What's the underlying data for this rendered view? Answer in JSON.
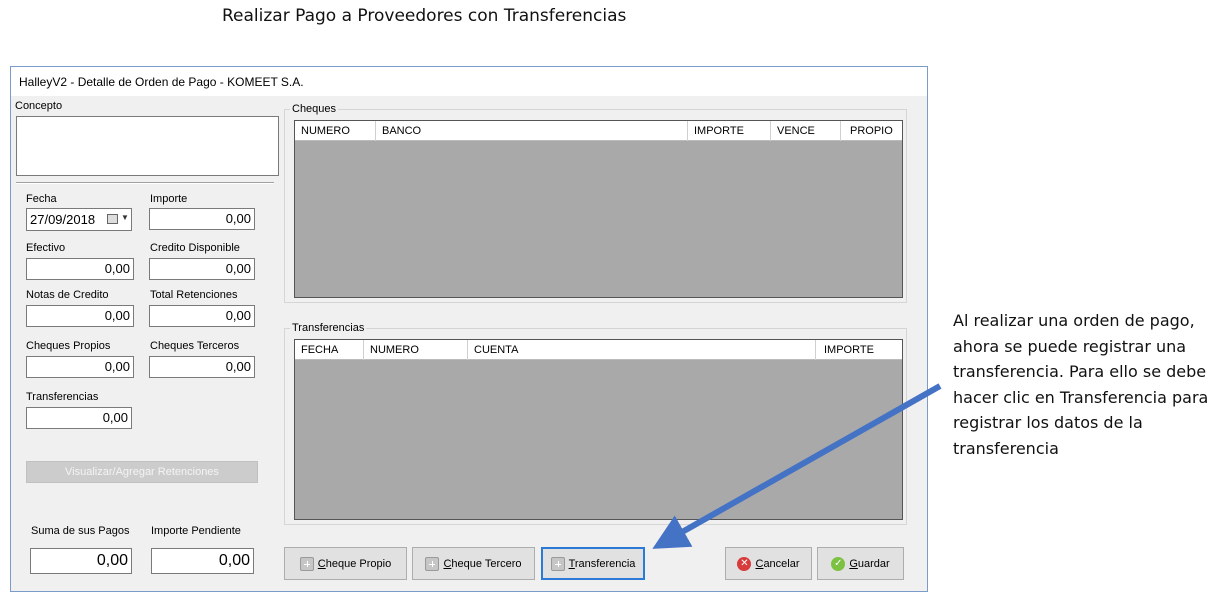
{
  "doc_title": "Realizar Pago a Proveedores con Transferencias",
  "window": {
    "title": "HalleyV2 - Detalle de Orden de Pago - KOMEET S.A."
  },
  "left": {
    "concepto_label": "Concepto",
    "concepto_value": "",
    "fecha_label": "Fecha",
    "fecha_value": "27/09/2018",
    "importe_label": "Importe",
    "importe_value": "0,00",
    "efectivo_label": "Efectivo",
    "efectivo_value": "0,00",
    "credito_label": "Credito Disponible",
    "credito_value": "0,00",
    "notas_label": "Notas de Credito",
    "notas_value": "0,00",
    "retenciones_label": "Total Retenciones",
    "retenciones_value": "0,00",
    "cheques_propios_label": "Cheques Propios",
    "cheques_propios_value": "0,00",
    "cheques_terceros_label": "Cheques Terceros",
    "cheques_terceros_value": "0,00",
    "transferencias_label": "Transferencias",
    "transferencias_value": "0,00",
    "retenciones_button": "Visualizar/Agregar Retenciones",
    "suma_label": "Suma de sus Pagos",
    "suma_value": "0,00",
    "pendiente_label": "Importe Pendiente",
    "pendiente_value": "0,00"
  },
  "cheques": {
    "legend": "Cheques",
    "columns": [
      "NUMERO",
      "BANCO",
      "IMPORTE",
      "VENCE",
      "PROPIO"
    ]
  },
  "transferencias": {
    "legend": "Transferencias",
    "columns": [
      "FECHA",
      "NUMERO",
      "CUENTA",
      "IMPORTE"
    ]
  },
  "buttons": {
    "cheque_propio": "Cheque Propio",
    "cheque_tercero": "Cheque Tercero",
    "transferencia": "Transferencia",
    "cancelar": "Cancelar",
    "guardar": "Guardar"
  },
  "annotation": {
    "text": "Al realizar una orden de pago, ahora se puede registrar una transferencia. Para ello se debe hacer clic en Transferencia para registrar los datos de la transferencia",
    "arrow_color": "#4472c4"
  }
}
